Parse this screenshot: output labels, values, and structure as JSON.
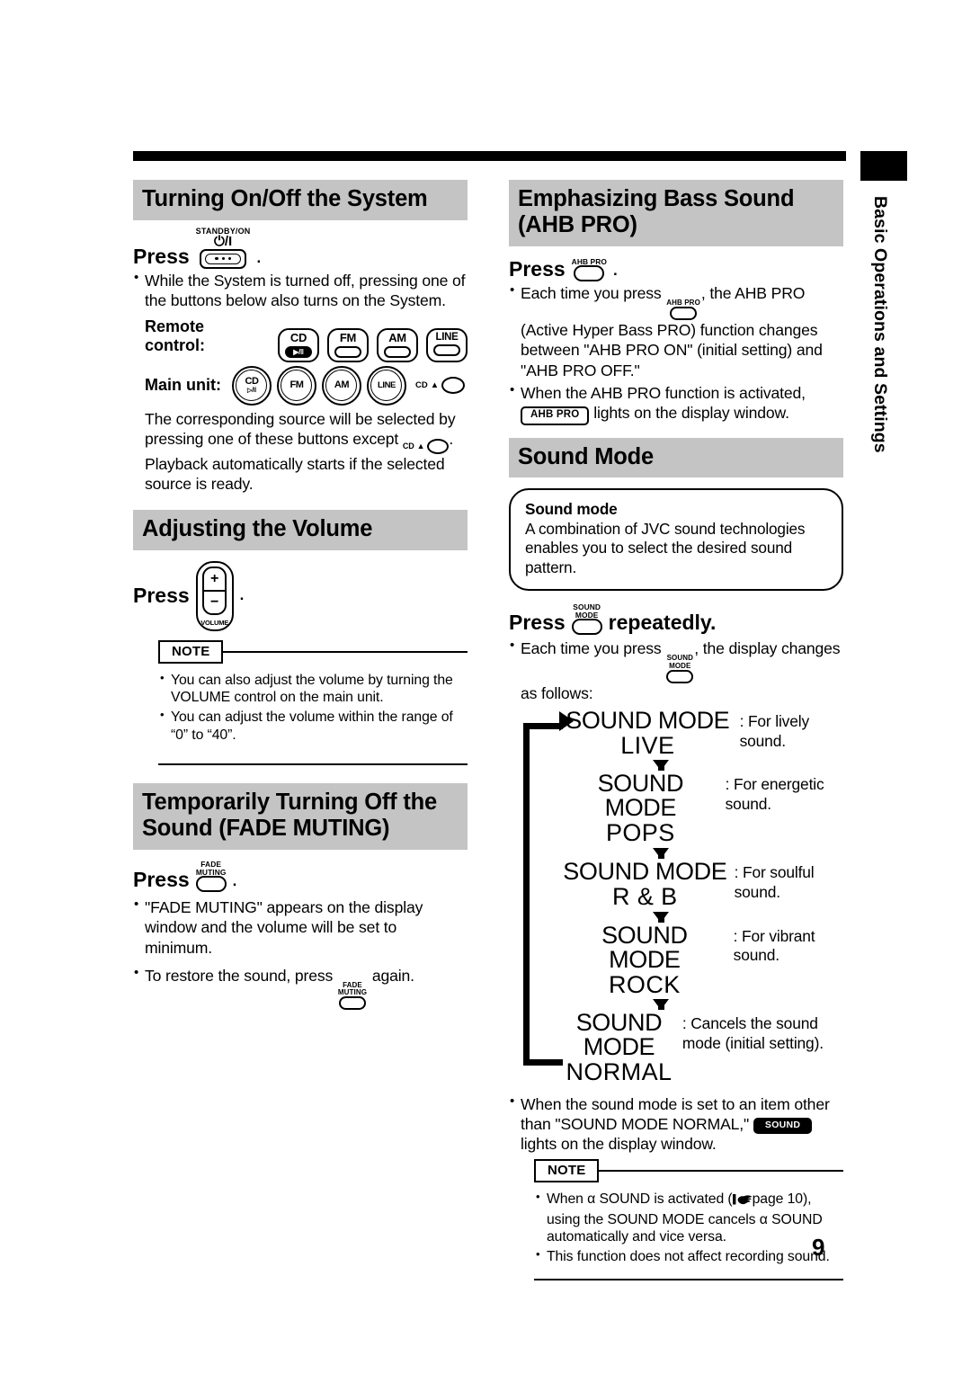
{
  "side_tab": {
    "label": "Basic Operations and Settings"
  },
  "page": {
    "number": "9"
  },
  "left_column": {
    "section_power": {
      "heading": "Turning On/Off the System",
      "press_label": "Press",
      "press_period": ".",
      "standby_button": {
        "caption": "STANDBY/ON",
        "symbol": "⏻/I",
        "icon": "standby-on-button"
      },
      "bullets": [
        "While the System is turned off, pressing one of the buttons below also turns on the System."
      ],
      "remote_label": "Remote control:",
      "main_unit_label": "Main unit:",
      "remote_buttons": [
        {
          "label": "CD",
          "sub": "▶/‖"
        },
        {
          "label": "FM",
          "sub": ""
        },
        {
          "label": "AM",
          "sub": ""
        },
        {
          "label": "LINE",
          "sub": ""
        }
      ],
      "main_unit_buttons": [
        {
          "label": "CD",
          "sub": "▷/‖"
        },
        {
          "label": "FM",
          "sub": ""
        },
        {
          "label": "AM",
          "sub": ""
        },
        {
          "label": "LINE",
          "sub": ""
        }
      ],
      "eject": {
        "label": "CD",
        "symbol": "▲"
      },
      "trailing_text_1": "The corresponding source will be selected by pressing one of these buttons except",
      "trailing_text_2": ". Playback automatically starts if the selected source is ready."
    },
    "section_volume": {
      "heading": "Adjusting the Volume",
      "press_label": "Press",
      "press_period": ".",
      "volume_button": {
        "plus": "+",
        "minus": "−",
        "label": "VOLUME",
        "icon": "volume-rocker-button"
      },
      "note": {
        "tag": "NOTE",
        "items": [
          "You can also adjust the volume by turning the VOLUME control on the main unit.",
          "You can adjust the volume within the range of “0” to “40”."
        ]
      }
    },
    "section_fade": {
      "heading": "Temporarily Turning Off the Sound (FADE MUTING)",
      "press_label": "Press",
      "press_period": ".",
      "fade_button": {
        "caption_line1": "FADE",
        "caption_line2": "MUTING",
        "icon": "fade-muting-button"
      },
      "bullets": [
        "\"FADE MUTING\" appears on the display window and the volume will be set to minimum.",
        "To restore the sound, press"
      ],
      "restore_tail": "again."
    }
  },
  "right_column": {
    "section_ahb": {
      "heading": "Emphasizing Bass Sound (AHB PRO)",
      "press_label": "Press",
      "press_period": ".",
      "ahb_button": {
        "caption": "AHB PRO",
        "icon": "ahb-pro-button"
      },
      "bullet1_pre": "Each time you press",
      "bullet1_post": ", the AHB PRO (Active Hyper Bass PRO) function changes between \"AHB PRO ON\" (initial setting) and \"AHB PRO OFF.\"",
      "bullet2_pre": "When the AHB PRO function is activated,",
      "bullet2_badge": "AHB PRO",
      "bullet2_post": "lights on the display window."
    },
    "section_sound_mode": {
      "heading": "Sound Mode",
      "callout": {
        "title": "Sound mode",
        "text": "A combination of JVC sound technologies enables you to select the desired sound pattern."
      },
      "press_label": "Press",
      "press_tail": "repeatedly.",
      "sound_mode_button": {
        "caption_line1": "SOUND",
        "caption_line2": "MODE",
        "icon": "sound-mode-button"
      },
      "bullet_pre": "Each time you press",
      "bullet_post": ", the display changes as follows:",
      "flow": [
        {
          "line1": "SOUND MODE",
          "line2": "LIVE",
          "desc": ": For lively sound."
        },
        {
          "line1": "SOUND MODE",
          "line2": "POPS",
          "desc": ": For energetic sound."
        },
        {
          "line1": "SOUND MODE",
          "line2": "R & B",
          "desc": ": For soulful sound."
        },
        {
          "line1": "SOUND MODE",
          "line2": "ROCK",
          "desc": ": For vibrant sound."
        },
        {
          "line1": "SOUND MODE",
          "line2": "NORMAL",
          "desc": ": Cancels the sound mode (initial setting)."
        }
      ],
      "after_bullet_pre": "When the sound mode is set to an item other than \"SOUND MODE NORMAL,\"",
      "after_bullet_badge": "SOUND",
      "after_bullet_post": "lights on the display window.",
      "note": {
        "tag": "NOTE",
        "item1_pre": "When α SOUND is activated (",
        "item1_page": "page 10",
        "item1_post": "), using the SOUND MODE cancels α SOUND automatically and vice versa.",
        "item2": "This function does not affect recording sound."
      }
    }
  },
  "colors": {
    "heading_bar": "#c4c4c4",
    "ink": "#000000",
    "paper": "#ffffff"
  }
}
